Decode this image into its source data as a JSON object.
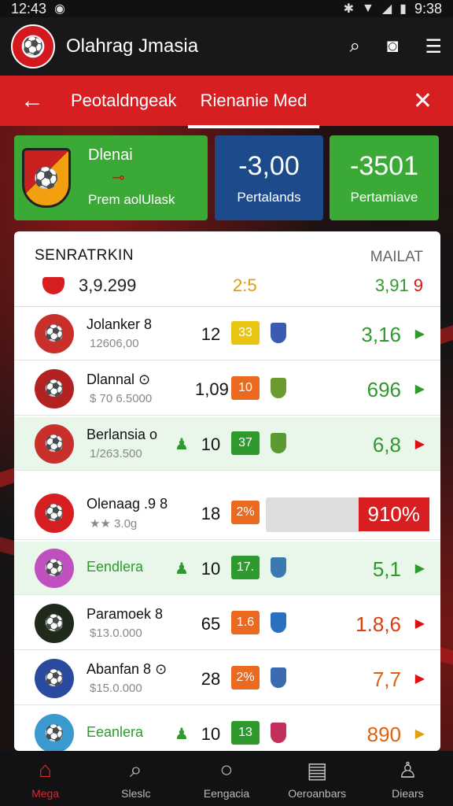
{
  "status_bar": {
    "time_left": "12:43",
    "time_right": "9:38"
  },
  "app": {
    "title": "Olahrag Jmasia"
  },
  "header": {
    "tabs": [
      {
        "label": "Peotaldngeak"
      },
      {
        "label": "Rienanie Med"
      }
    ]
  },
  "summary": {
    "card_a": {
      "title": "Dlenai",
      "label": "Prem aolUlask"
    },
    "card_b": {
      "value": "-3,00",
      "label": "Pertalands"
    },
    "card_c": {
      "value": "-3501",
      "label": "Pertamiave"
    }
  },
  "panel": {
    "title": "SENRATRKIN",
    "link": "MAILAT",
    "sub_value": "3,9.299",
    "sub_mid": "2:5",
    "sub_right": "3,91",
    "sub_right_flag": "9"
  },
  "rows": [
    {
      "name": "Jolanker 8",
      "sub": "12606,00",
      "num": "12",
      "chip": "33",
      "chip_color": "#e8c512",
      "val": "3,16",
      "val_color": "#2e9a2e",
      "go": "▶",
      "go_color": "#2e9a2e",
      "badge_color": "#c9302c",
      "mini_color": "#3b5bb0",
      "person": ""
    },
    {
      "name": "Dlannal ⊙",
      "sub": "$ 70 6.5000",
      "num": "1,09",
      "chip": "10",
      "chip_color": "#ec6a20",
      "val": "696",
      "val_color": "#2e9a2e",
      "go": "▶",
      "go_color": "#2e9a2e",
      "badge_color": "#b22222",
      "mini_color": "#6a9a30",
      "person": ""
    },
    {
      "name": "Berlansia o",
      "sub": "1/263.500",
      "num": "10",
      "chip": "37",
      "chip_color": "#2e9a2e",
      "val": "6,8",
      "val_color": "#2e9a2e",
      "go": "▶",
      "go_color": "#d11",
      "badge_color": "#c9302c",
      "mini_color": "#5a9a30",
      "person": "♟"
    },
    {
      "name": "Olenaag .9 8",
      "sub": "★★ 3.0g",
      "num": "18",
      "chip": "2%",
      "chip_color": "#ec6a20",
      "val": "910%",
      "val_color": "#d11",
      "go": "",
      "go_color": "#d11",
      "badge_color": "#d71f22",
      "mini_color": "#d71f22",
      "person": ""
    },
    {
      "name": "Eendlera",
      "sub": "",
      "num": "10",
      "chip": "17.",
      "chip_color": "#2e9a2e",
      "val": "5,1",
      "val_color": "#2e9a2e",
      "go": "▶",
      "go_color": "#2e9a2e",
      "badge_color": "#c050c0",
      "mini_color": "#3b7ab0",
      "person": "♟"
    },
    {
      "name": "Paramoek 8",
      "sub": "$13.0.000",
      "num": "65",
      "chip": "1.6",
      "chip_color": "#ec6a20",
      "val": "1.8,6",
      "val_color": "#d84010",
      "go": "▶",
      "go_color": "#d11",
      "badge_color": "#1f2a1a",
      "mini_color": "#2a70c0",
      "person": ""
    },
    {
      "name": "Abanfan 8 ⊙",
      "sub": "$15.0.000",
      "num": "28",
      "chip": "2%",
      "chip_color": "#ec6a20",
      "val": "7,7",
      "val_color": "#e06010",
      "go": "▶",
      "go_color": "#d11",
      "badge_color": "#2a4aa0",
      "mini_color": "#3a6ab0",
      "person": ""
    },
    {
      "name": "Eeanlera",
      "sub": "",
      "num": "10",
      "chip": "13",
      "chip_color": "#2e9a2e",
      "val": "890",
      "val_color": "#e06010",
      "go": "▶",
      "go_color": "#e0a010",
      "badge_color": "#3a9ad0",
      "mini_color": "#c0305a",
      "person": "♟"
    }
  ],
  "row_icons": [
    "player-icon",
    "club-crest-icon",
    "club-crest-icon",
    "ball-icon",
    "club-crest-icon",
    "club-crest-icon",
    "player-icon",
    "club-crest-icon"
  ],
  "nav": [
    {
      "label": "Mega"
    },
    {
      "label": "Sleslc"
    },
    {
      "label": "Eengacia"
    },
    {
      "label": "Oeroanbars"
    },
    {
      "label": "Diears"
    }
  ]
}
